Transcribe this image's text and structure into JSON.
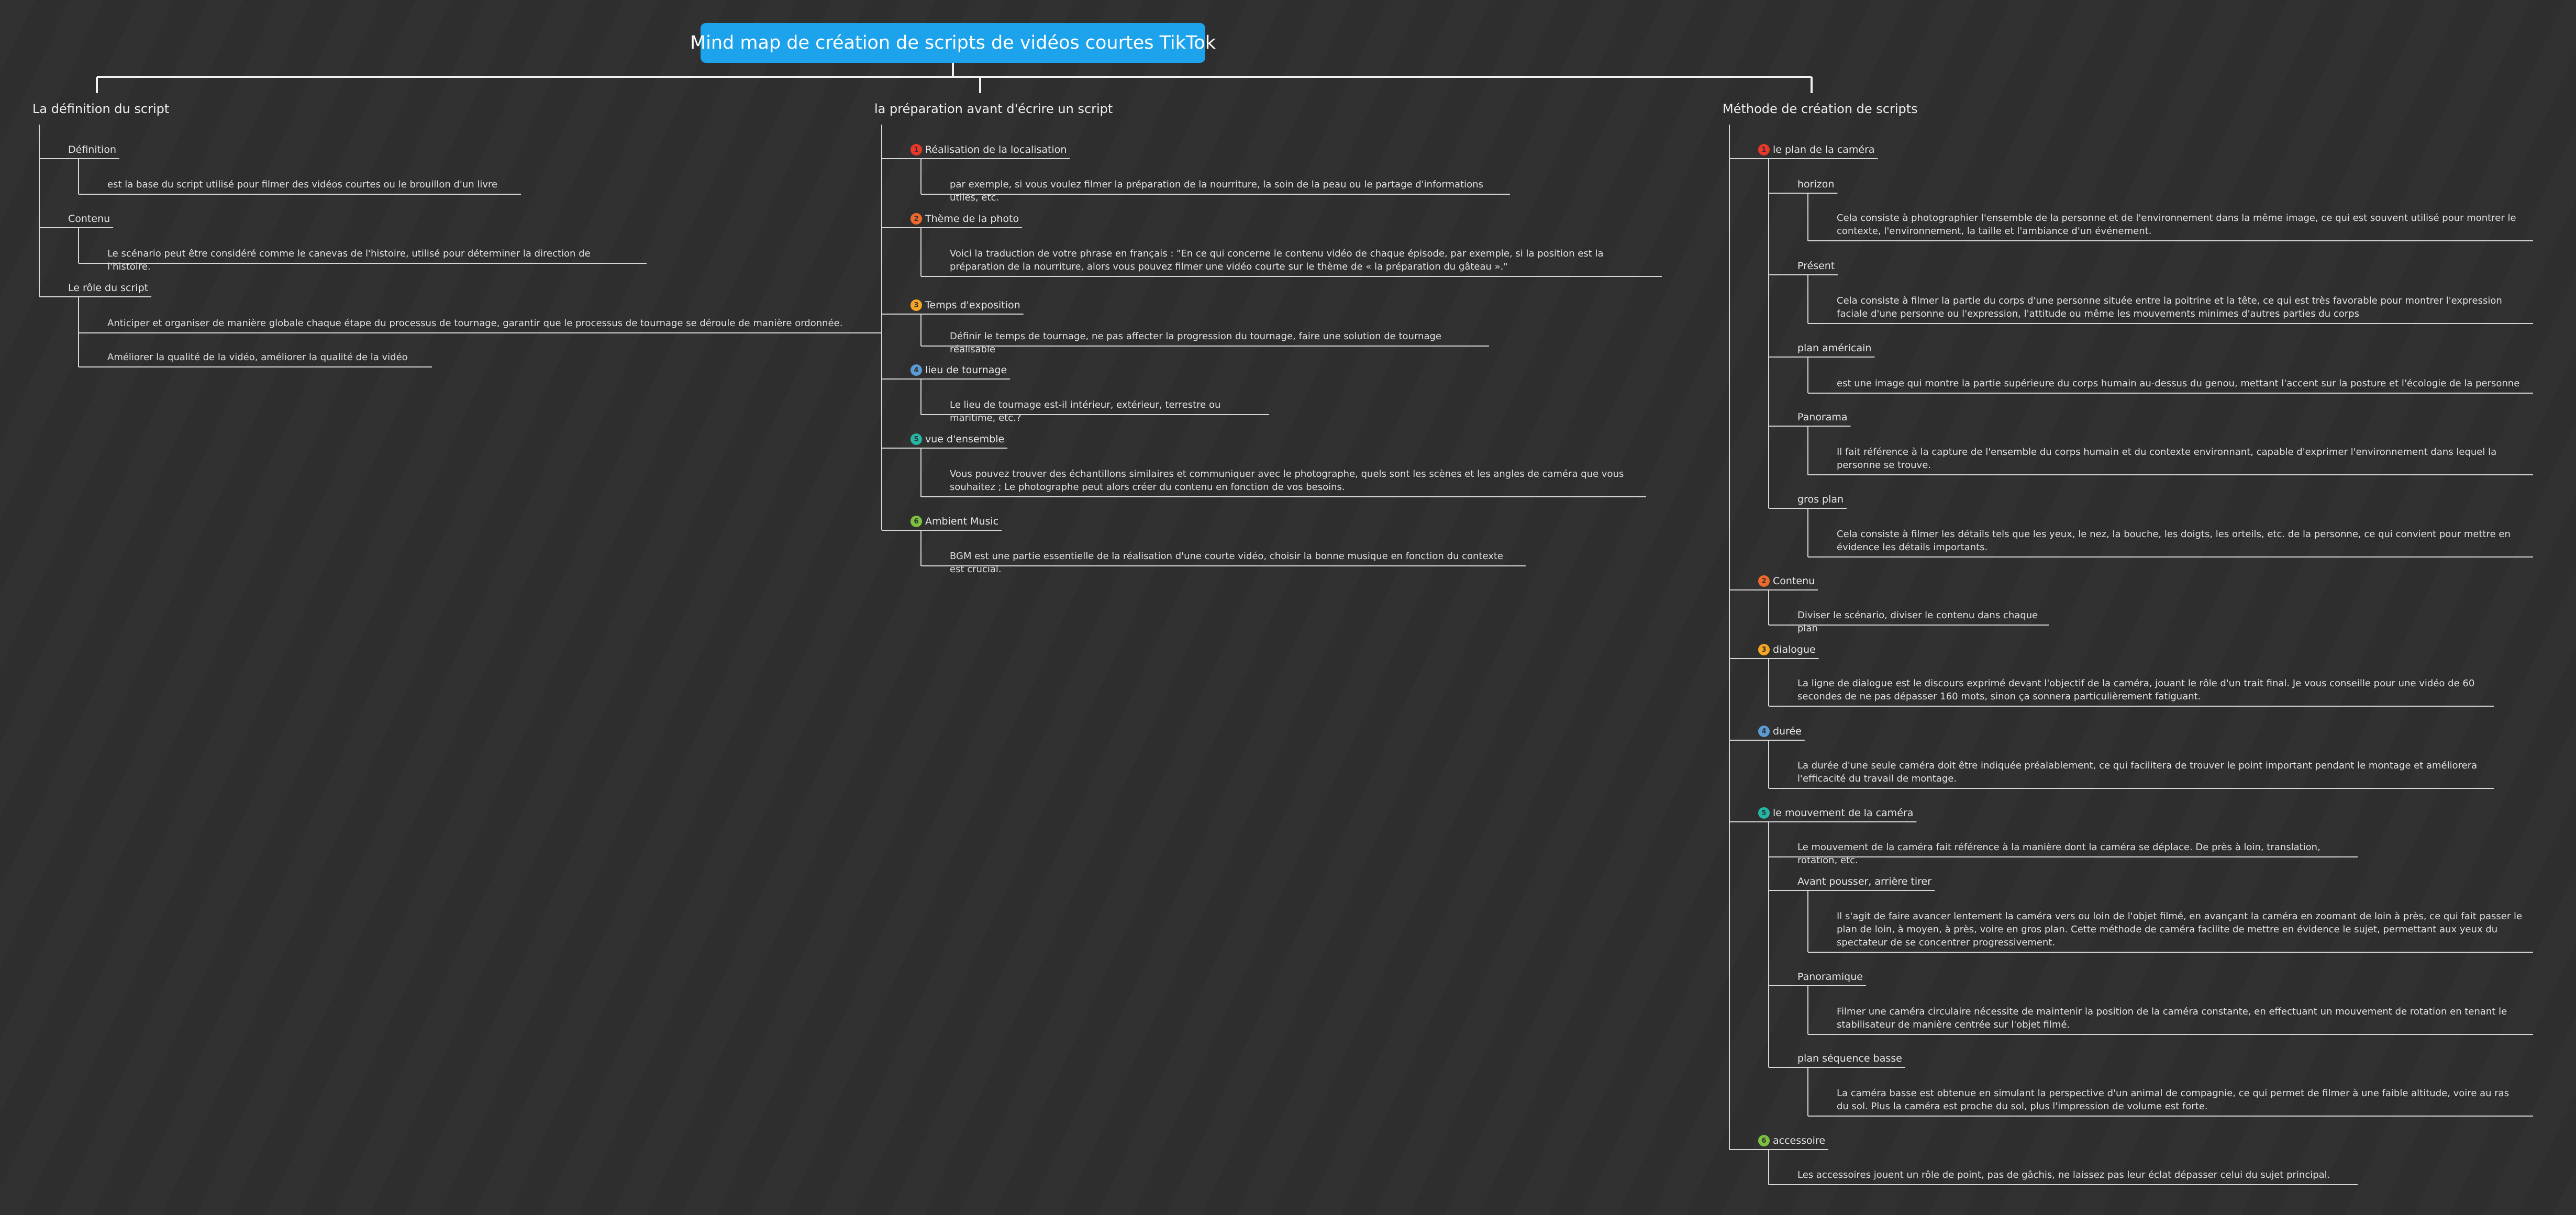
{
  "root": {
    "title": "Mind map de création de scripts de vidéos courtes TikTok"
  },
  "badge_colors": [
    "#e8382b",
    "#ee6a2a",
    "#f5a623",
    "#5b9bd5",
    "#26b6a6",
    "#7cc140"
  ],
  "branches": [
    {
      "label": "La définition du script",
      "children": [
        {
          "label": "Définition",
          "children": [
            {
              "text": "est la base du script utilisé pour filmer des vidéos courtes ou le brouillon d'un livre"
            }
          ]
        },
        {
          "label": "Contenu",
          "children": [
            {
              "text": "Le scénario peut être considéré comme le canevas de l'histoire, utilisé pour déterminer la direction de l'histoire."
            }
          ]
        },
        {
          "label": "Le rôle du script",
          "children": [
            {
              "text": "Anticiper et organiser de manière globale chaque étape du processus de tournage, garantir que le processus de tournage se déroule de manière ordonnée."
            },
            {
              "text": "Améliorer la qualité de la vidéo, améliorer la qualité de la vidéo"
            }
          ]
        }
      ]
    },
    {
      "label": "la préparation avant d'écrire un script",
      "children": [
        {
          "label": "Réalisation de la localisation",
          "badge": "1",
          "children": [
            {
              "text": "par exemple, si vous voulez filmer la préparation de la nourriture, la soin de la peau ou le partage d'informations utiles, etc."
            }
          ]
        },
        {
          "label": "Thème de la photo",
          "badge": "2",
          "children": [
            {
              "text": "Voici la traduction de votre phrase en français : \"En ce qui concerne le contenu vidéo de chaque épisode, par exemple, si la position est la préparation de la nourriture, alors vous pouvez filmer une vidéo courte sur le thème de « la préparation du gâteau ».\""
            }
          ]
        },
        {
          "label": "Temps d'exposition",
          "badge": "3",
          "children": [
            {
              "text": "Définir le temps de tournage, ne pas affecter la progression du tournage, faire une solution de tournage réalisable"
            }
          ]
        },
        {
          "label": "lieu de tournage",
          "badge": "4",
          "children": [
            {
              "text": "Le lieu de tournage est-il intérieur, extérieur, terrestre ou maritime, etc.?"
            }
          ]
        },
        {
          "label": "vue d'ensemble",
          "badge": "5",
          "children": [
            {
              "text": "Vous pouvez trouver des échantillons similaires et communiquer avec le photographe, quels sont les scènes et les angles de caméra que vous souhaitez ; Le photographe peut alors créer du contenu en fonction de vos besoins."
            }
          ]
        },
        {
          "label": "Ambient Music",
          "badge": "6",
          "children": [
            {
              "text": "BGM est une partie essentielle de la réalisation d'une courte vidéo, choisir la bonne musique en fonction du contexte est crucial."
            }
          ]
        }
      ]
    },
    {
      "label": "Méthode de création de scripts",
      "children": [
        {
          "label": "le plan de la caméra",
          "badge": "1",
          "children": [
            {
              "label": "horizon",
              "children": [
                {
                  "text": "Cela consiste à photographier l'ensemble de la personne et de l'environnement dans la même image, ce qui est souvent utilisé pour montrer le contexte, l'environnement, la taille et l'ambiance d'un événement."
                }
              ]
            },
            {
              "label": "Présent",
              "children": [
                {
                  "text": "Cela consiste à filmer la partie du corps d'une personne située entre la poitrine et la tête, ce qui est très favorable pour montrer l'expression faciale d'une personne ou l'expression, l'attitude ou même les mouvements minimes d'autres parties du corps"
                }
              ]
            },
            {
              "label": "plan américain",
              "children": [
                {
                  "text": "est une image qui montre la partie supérieure du corps humain au-dessus du genou, mettant l'accent sur la posture et l'écologie de la personne"
                }
              ]
            },
            {
              "label": "Panorama",
              "children": [
                {
                  "text": "Il fait référence à la capture de l'ensemble du corps humain et du contexte environnant, capable d'exprimer l'environnement dans lequel la personne se trouve."
                }
              ]
            },
            {
              "label": "gros plan",
              "children": [
                {
                  "text": "Cela consiste à filmer les détails tels que les yeux, le nez, la bouche, les doigts, les orteils, etc. de la personne, ce qui convient pour mettre en évidence les détails importants."
                }
              ]
            }
          ]
        },
        {
          "label": "Contenu",
          "badge": "2",
          "children": [
            {
              "text": "Diviser le scénario, diviser le contenu dans chaque plan"
            }
          ]
        },
        {
          "label": "dialogue",
          "badge": "3",
          "children": [
            {
              "text": "La ligne de dialogue est le discours exprimé devant l'objectif de la caméra, jouant le rôle d'un trait final. Je vous conseille pour une vidéo de 60 secondes de ne pas dépasser 160 mots, sinon ça sonnera particulièrement fatiguant."
            }
          ]
        },
        {
          "label": "durée",
          "badge": "4",
          "children": [
            {
              "text": "La durée d'une seule caméra doit être indiquée préalablement, ce qui facilitera de trouver le point important pendant le montage et améliorera l'efficacité du travail de montage."
            }
          ]
        },
        {
          "label": "le mouvement de la caméra",
          "badge": "5",
          "children": [
            {
              "text": "Le mouvement de la caméra fait référence à la manière dont la caméra se déplace. De près à loin, translation, rotation, etc."
            },
            {
              "label": "Avant pousser, arrière tirer",
              "children": [
                {
                  "text": "Il s'agit de faire avancer lentement la caméra vers ou loin de l'objet filmé, en avançant la caméra en zoomant de loin à près, ce qui fait passer le plan de loin, à moyen, à près, voire en gros plan. Cette méthode de caméra facilite de mettre en évidence le sujet, permettant aux yeux du spectateur de se concentrer progressivement."
                }
              ]
            },
            {
              "label": "Panoramique",
              "children": [
                {
                  "text": "Filmer une caméra circulaire nécessite de maintenir la position de la caméra constante, en effectuant un mouvement de rotation en tenant le stabilisateur de manière centrée sur l'objet filmé."
                }
              ]
            },
            {
              "label": "plan séquence basse",
              "children": [
                {
                  "text": "La caméra basse est obtenue en simulant la perspective d'un animal de compagnie, ce qui permet de filmer à une faible altitude, voire au ras du sol. Plus la caméra est proche du sol, plus l'impression de volume est forte."
                }
              ]
            }
          ]
        },
        {
          "label": "accessoire",
          "badge": "6",
          "children": [
            {
              "text": "Les accessoires jouent un rôle de point, pas de gâchis, ne laissez pas leur éclat dépasser celui du sujet principal."
            }
          ]
        }
      ]
    }
  ]
}
